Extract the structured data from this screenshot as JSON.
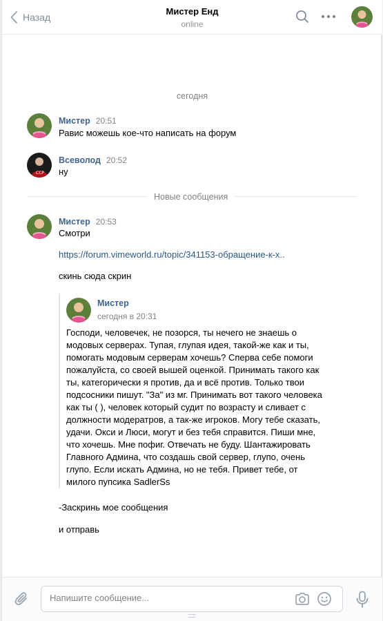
{
  "header": {
    "back_label": "Назад",
    "title": "Мистер Енд",
    "status": "online"
  },
  "chat": {
    "date_separator": "сегодня",
    "new_messages_label": "Новые сообщения",
    "messages": [
      {
        "author": "Мистер",
        "time": "20:51",
        "text": "Равис можешь кое-что написать на форум"
      },
      {
        "author": "Всеволод",
        "time": "20:52",
        "text": "ну"
      },
      {
        "author": "Мистер",
        "time": "20:53",
        "text": "Смотри",
        "link": "https://forum.vimeworld.ru/topic/341153-обращение-к-х..",
        "text2": "скинь сюда скрин",
        "forwarded": {
          "author": "Мистер",
          "date": "сегодня в 20:31",
          "text": "Господи, человечек, не позорся, ты нечего не знаешь о модовых серверах. Тупая, глупая идея, такой-же как и ты, помогать модовым серверам хочешь? Сперва себе помоги пожалуйста, со своей вышей оценкой. Принимать такого как ты, категорически я против, да и всё против. Только твои подсосники пишут. \"За\" из мг. Принимать вот такого человека как ты ( ), человек который судит по возрасту и сливает с должности модератров, а так-же игроков. Могу тебе сказать, удачи. Окси и Люси, могут и без тебя справится. Пиши мне, что хочешь. Мне пофиг. Отвечать не буду. Шантажировать Главного Админа, что создашь свой сервер, глупо, очень глупо. Если искать Админа, но не тебя. Привет тебе, от милого пупсика SadlerSs"
        },
        "text3": "-Заскринь мое сообщения",
        "text4": "и отправь"
      }
    ]
  },
  "composer": {
    "placeholder": "Напишите сообщение..."
  },
  "colors": {
    "author": "#42648b",
    "link": "#2a5885",
    "muted": "#828282"
  }
}
